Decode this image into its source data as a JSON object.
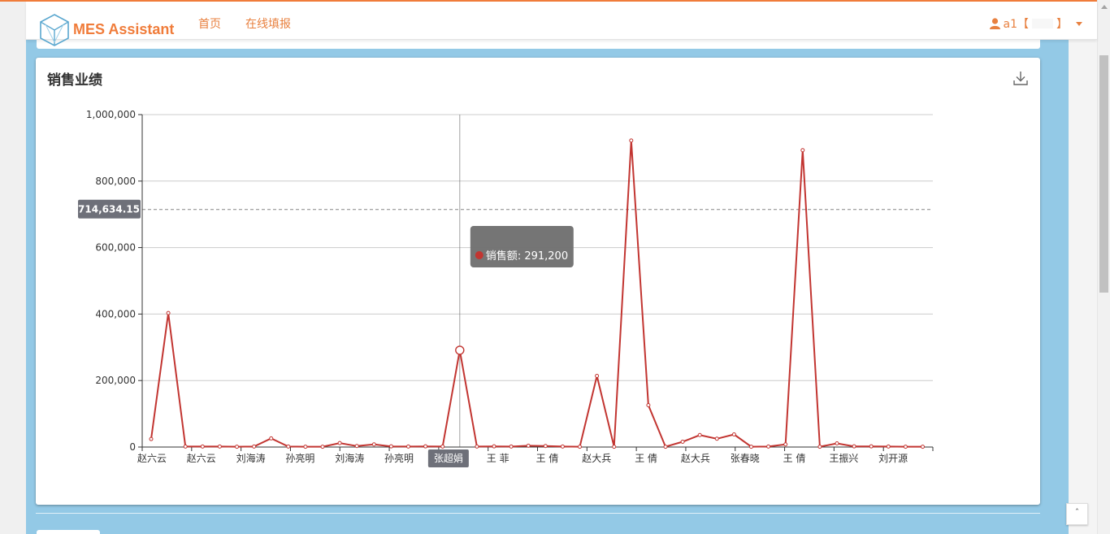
{
  "header": {
    "brand": "MES Assistant",
    "nav": [
      "首页",
      "在线填报"
    ],
    "user": "a1【",
    "user_suffix": "】"
  },
  "panel": {
    "title": "销售业绩"
  },
  "back_to_top": "ˆ",
  "chart_data": {
    "type": "line",
    "title": "销售业绩",
    "ylim": [
      0,
      1000000
    ],
    "y_ticks": [
      "1,000,000",
      "800,000",
      "600,000",
      "400,000",
      "200,000",
      "0"
    ],
    "series": [
      {
        "name": "销售额",
        "color": "#c23531",
        "values": [
          24000,
          403000,
          1500,
          1500,
          1500,
          1000,
          1500,
          26000,
          1500,
          1000,
          1000,
          12000,
          3000,
          8000,
          2000,
          1500,
          2000,
          1500,
          291200,
          1500,
          2000,
          1500,
          4000,
          3000,
          1500,
          1000,
          214000,
          1000,
          922000,
          126000,
          1000,
          16000,
          36000,
          25000,
          38000,
          1000,
          1500,
          8000,
          893000,
          1000,
          11000,
          2000,
          2000,
          1500,
          1000,
          1000
        ]
      }
    ],
    "x_labels": [
      "赵六云",
      "赵六云",
      "刘海涛",
      "孙亮明",
      "刘海涛",
      "孙亮明",
      "张超娟",
      "王  菲",
      "王  倩",
      "赵大兵",
      "王  倩",
      "赵大兵",
      "张春晓",
      "王  倩",
      "王振兴",
      "刘开源"
    ],
    "highlighted_label_index": 6,
    "tooltip": {
      "series_name": "销售额",
      "value": "291,200",
      "point_index": 18
    },
    "crosshair_y_label": "714,634.15",
    "crosshair_y_value": 714634.15,
    "grid": true,
    "colors": {
      "line": "#c23531",
      "axis": "#333333",
      "grid": "#cccccc",
      "tooltip_bg": "#6e6e6e",
      "pointer_label_bg": "#6e7079"
    }
  }
}
